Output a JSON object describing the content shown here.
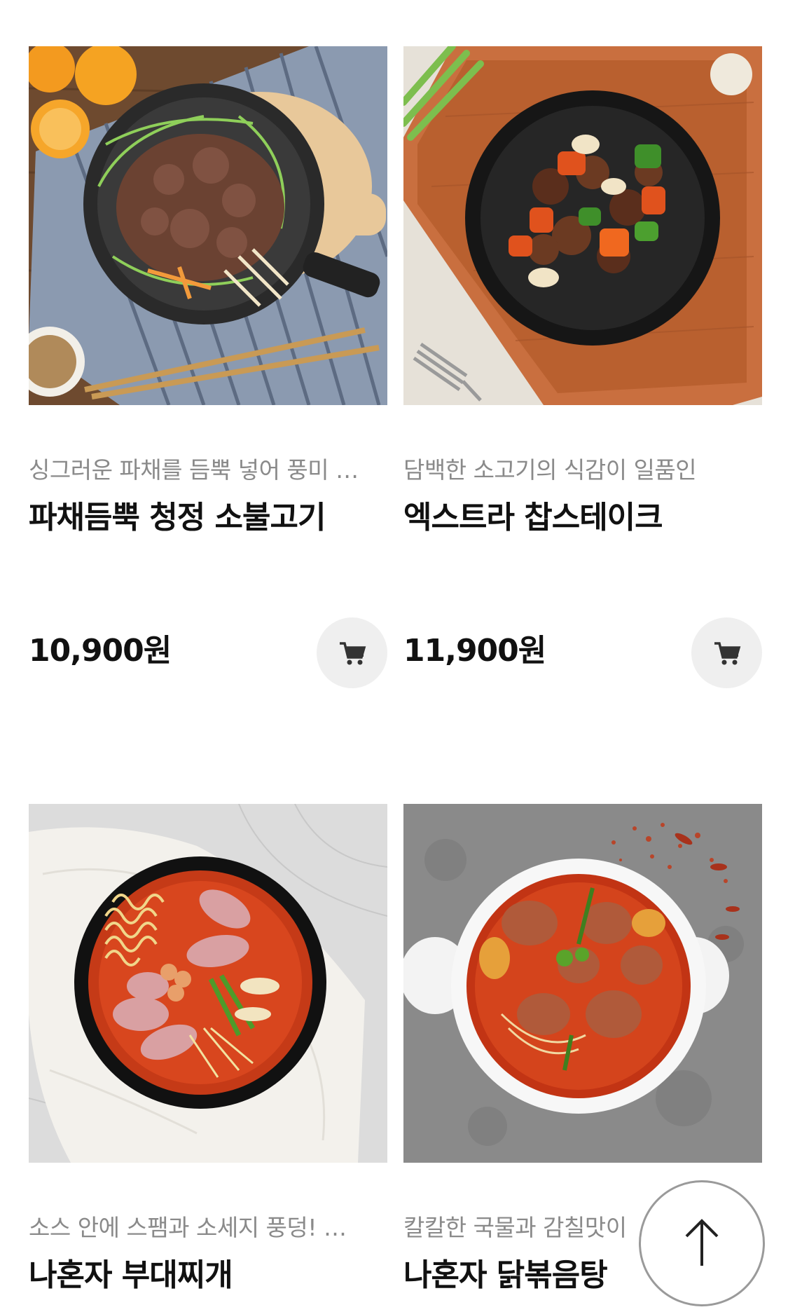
{
  "products": [
    {
      "description": "싱그러운 파채를 듬뿍 넣어 풍미 …",
      "name": "파채듬뿍 청정 소불고기",
      "price": "10,900원",
      "image_icon": "beef-bulgogi-skillet-image"
    },
    {
      "description": "담백한 소고기의 식감이 일품인",
      "name": "엑스트라 찹스테이크",
      "price": "11,900원",
      "image_icon": "chop-steak-plate-image"
    },
    {
      "description": "소스 안에 스팸과 소세지 풍덩! …",
      "name": "나혼자 부대찌개",
      "price": "",
      "image_icon": "army-stew-bowl-image"
    },
    {
      "description": "칼칼한 국물과 감칠맛이",
      "name": "나혼자 닭볶음탕",
      "price": "",
      "image_icon": "spicy-chicken-stew-image"
    }
  ],
  "icons": {
    "cart": "cart-icon",
    "scroll_top": "arrow-up-icon"
  },
  "colors": {
    "cart_button_bg": "#efefef",
    "price_text": "#111111",
    "description_text": "#8a8a8a"
  }
}
